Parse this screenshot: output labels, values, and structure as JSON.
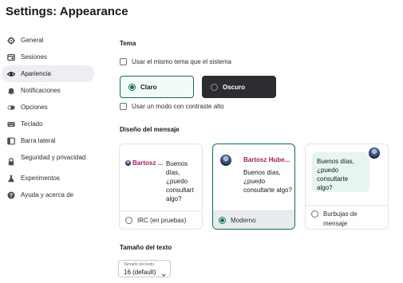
{
  "window": {
    "title": "Settings: Appearance"
  },
  "sidebar": {
    "items": [
      {
        "label": "General",
        "icon": "gear-icon"
      },
      {
        "label": "Sesiones",
        "icon": "window-icon"
      },
      {
        "label": "Apariencia",
        "icon": "eye-icon",
        "active": true
      },
      {
        "label": "Notificaciones",
        "icon": "bell-icon"
      },
      {
        "label": "Opciones",
        "icon": "toggle-icon"
      },
      {
        "label": "Teclado",
        "icon": "keyboard-icon"
      },
      {
        "label": "Barra lateral",
        "icon": "sidebar-icon"
      },
      {
        "label": "Seguridad y privacidad",
        "icon": "lock-icon"
      },
      {
        "label": "Experimentos",
        "icon": "flask-icon"
      },
      {
        "label": "Ayuda y acerca de",
        "icon": "help-icon"
      }
    ]
  },
  "theme": {
    "heading": "Tema",
    "use_system_label": "Usar el mismo tema que el sistema",
    "light_label": "Claro",
    "dark_label": "Oscuro",
    "selected": "light",
    "high_contrast_label": "Usar un modo con contraste alto"
  },
  "message_layout": {
    "heading": "Diseño del mensaje",
    "irc": {
      "sender": "Bartosz ...",
      "message": "Buenos días, ¿puedo consultart algo?",
      "label": "IRC (en pruebas)"
    },
    "modern": {
      "sender": "Bartosz Hube...",
      "message": "Buenos días, ¿puedo consultarte algo?",
      "label": "Moderno",
      "selected": true
    },
    "bubbles": {
      "message": "Buenos días, ¿puedo consultarte algo?",
      "label": "Burbujas de mensaje"
    }
  },
  "text_size": {
    "heading": "Tamaño del texto",
    "legend": "Tamaño del texto",
    "value": "16 (default)"
  },
  "colors": {
    "accent": "#0e6d5a",
    "sender": "#a51b5c",
    "dark_theme_bg": "#2b2d31",
    "bubble_bg": "#e6f5ee"
  }
}
